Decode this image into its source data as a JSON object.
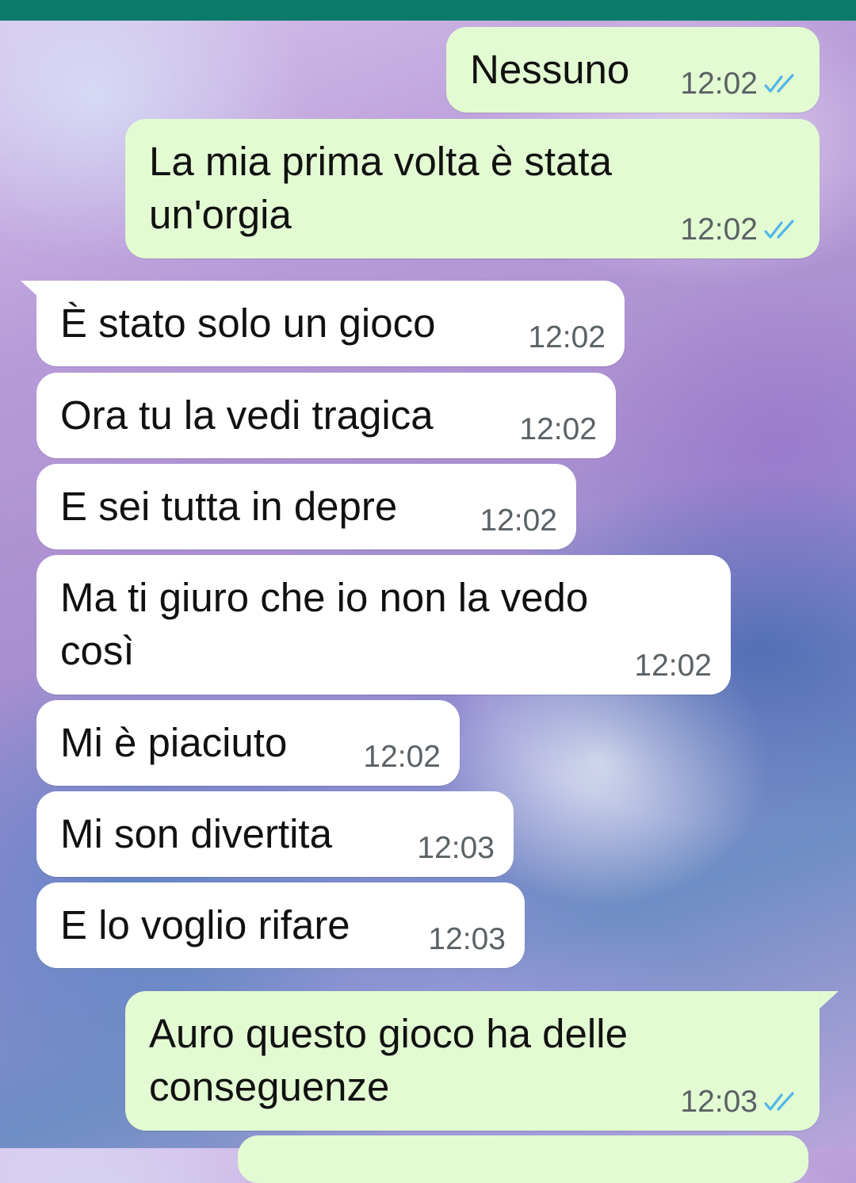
{
  "messages": [
    {
      "text": "Nessuno",
      "time": "12:02",
      "status": "read"
    },
    {
      "text": "La mia prima volta è stata\nun'orgia",
      "time": "12:02",
      "status": "read"
    },
    {
      "text": "È stato solo un gioco",
      "time": "12:02"
    },
    {
      "text": "Ora tu la vedi tragica",
      "time": "12:02"
    },
    {
      "text": "E sei tutta in depre",
      "time": "12:02"
    },
    {
      "text": "Ma ti giuro che io non la vedo\ncosì",
      "time": "12:02"
    },
    {
      "text": "Mi è piaciuto",
      "time": "12:02"
    },
    {
      "text": "Mi son divertita",
      "time": "12:03"
    },
    {
      "text": "E lo voglio rifare",
      "time": "12:03"
    },
    {
      "text": "Auro questo gioco ha delle\nconseguenze",
      "time": "12:03",
      "status": "read"
    }
  ],
  "colors": {
    "header": "#0b7a6b",
    "outgoing_bubble": "#e3fbd2",
    "incoming_bubble": "#ffffff",
    "read_ticks": "#4fb6ec",
    "timestamp": "#5b6266"
  },
  "icons": {
    "read_receipt": "double-check-icon"
  }
}
